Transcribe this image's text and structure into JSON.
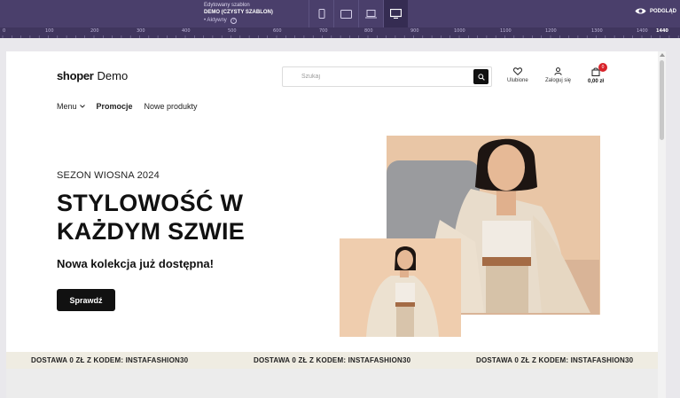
{
  "editor": {
    "template_label": "Edytowany szablon",
    "template_name": "DEMO (CZYSTY SZABLON)",
    "template_status": "• Aktywny",
    "help_icon_text": "?",
    "devices": [
      {
        "name": "mobile",
        "icon": "mobile-icon"
      },
      {
        "name": "tablet",
        "icon": "tablet-icon"
      },
      {
        "name": "laptop",
        "icon": "laptop-icon"
      },
      {
        "name": "desktop",
        "icon": "desktop-icon",
        "active": true
      }
    ],
    "preview_label": "PODGLĄD",
    "colors": {
      "bar": "#4a3f6b",
      "ruler": "#40365e"
    }
  },
  "ruler": {
    "labels": [
      "0",
      "100",
      "200",
      "300",
      "400",
      "500",
      "600",
      "700",
      "800",
      "900",
      "1000",
      "1100",
      "1200",
      "1300",
      "1400",
      "1440"
    ]
  },
  "store": {
    "logo": {
      "brand": "shoper",
      "suffix": "Demo"
    },
    "search": {
      "placeholder": "Szukaj"
    },
    "actions": {
      "favorites": "Ulubione",
      "login": "Zaloguj się",
      "cart_price": "0,00 zł",
      "cart_count": "0"
    },
    "nav": [
      {
        "label": "Menu",
        "has_dropdown": true
      },
      {
        "label": "Promocje",
        "bold": true
      },
      {
        "label": "Nowe produkty"
      }
    ]
  },
  "hero": {
    "season": "SEZON WIOSNA 2024",
    "headline_line1": "STYLOWOŚĆ W",
    "headline_line2": "KAŻDYM SZWIE",
    "subline": "Nowa kolekcja już dostępna!",
    "cta": "Sprawdź",
    "accent": "#111111"
  },
  "promo": {
    "items": [
      "DOSTAWA 0 ZŁ Z KODEM: INSTAFASHION30",
      "DOSTAWA 0 ZŁ Z KODEM: INSTAFASHION30",
      "DOSTAWA 0 ZŁ Z KODEM: INSTAFASHION30"
    ],
    "background": "#efece2"
  }
}
